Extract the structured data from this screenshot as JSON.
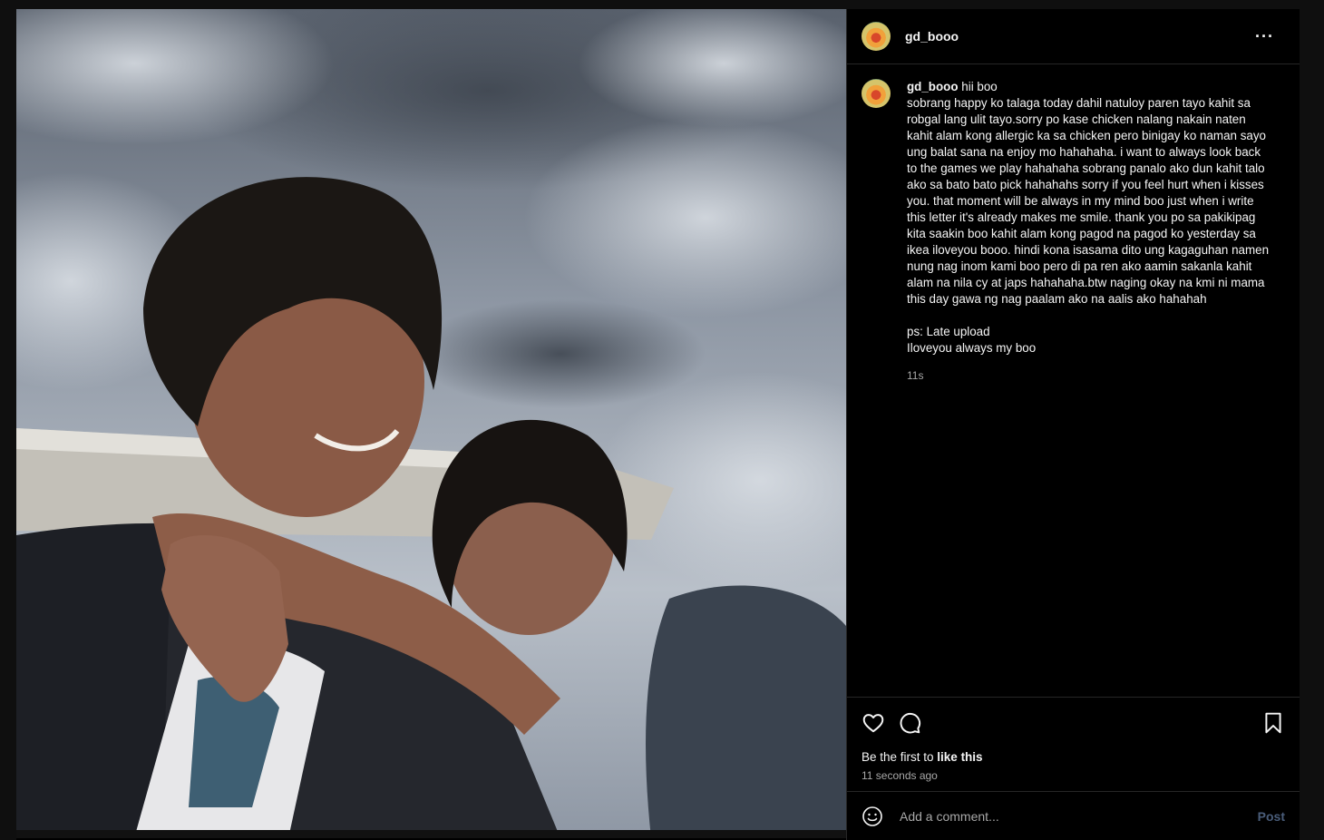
{
  "post": {
    "username": "gd_booo",
    "more_label": "···",
    "caption_first_line": "hii boo",
    "caption_text": "sobrang happy ko talaga today dahil natuloy paren tayo kahit sa robgal lang ulit tayo.sorry po kase chicken nalang nakain naten kahit alam kong allergic ka sa chicken pero binigay ko naman sayo ung balat sana na enjoy mo hahahaha. i want to always look back to the games we play hahahaha sobrang panalo ako dun kahit talo ako sa bato bato pick hahahahs sorry if you feel hurt when i kisses you. that moment will be always in my mind boo just when i write this letter it's already makes me smile. thank you po sa pakikipag kita saakin boo kahit alam kong pagod na pagod ko yesterday sa ikea iloveyou booo. hindi kona isasama dito ung kagaguhan namen nung nag inom kami boo pero di pa ren ako aamin sakanla kahit alam na nila cy at japs hahahaha.btw naging okay na kmi ni mama this day gawa ng nag paalam ako na aalis ako hahahah",
    "caption_ps": "ps: Late upload",
    "caption_last": "Iloveyou always my boo",
    "caption_time": "11s",
    "likes_prefix": "Be the first to ",
    "likes_link": "like this",
    "posted_ago": "11 seconds ago",
    "comment_placeholder": "Add a comment...",
    "post_button": "Post"
  },
  "icons": {
    "like": "heart-icon",
    "comment": "comment-bubble-icon",
    "save": "bookmark-icon",
    "emoji": "emoji-smile-icon",
    "more": "more-horizontal-icon"
  },
  "colors": {
    "background": "#000000",
    "text": "#f5f5f5",
    "muted": "#a8a8a8",
    "divider": "#262626",
    "post_button": "#4a5d7a"
  }
}
